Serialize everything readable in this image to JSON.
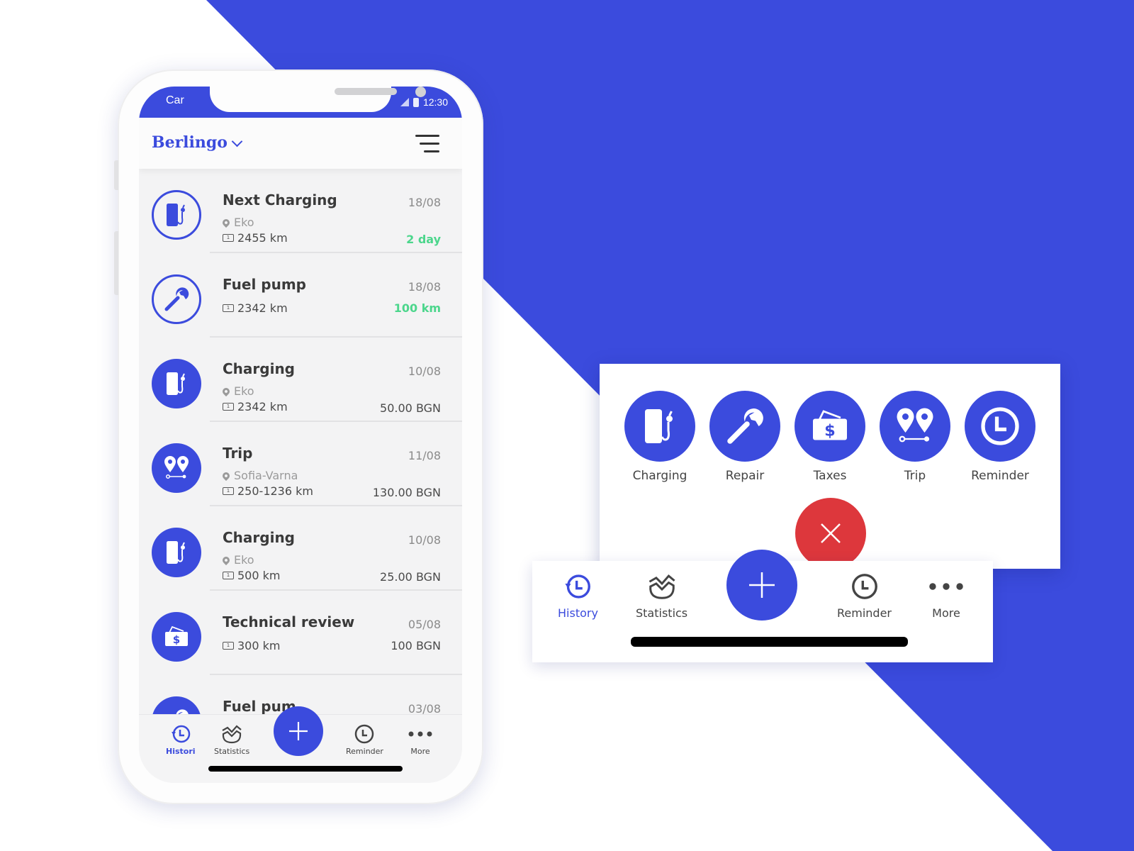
{
  "colors": {
    "brand_blue": "#3b4bdd",
    "danger_red": "#dd373c",
    "positive_green": "#4cd68c",
    "background": "#ffffff"
  },
  "phone": {
    "status_bar": {
      "carrier": "Car",
      "time": "12:30",
      "icons": [
        "signal-icon",
        "battery-icon"
      ]
    },
    "app_bar": {
      "vehicle_selector": "Berlingo",
      "menu_icon": "hamburger-menu-icon"
    },
    "list": [
      {
        "title": "Next Charging",
        "date": "18/08",
        "location": "Eko",
        "odometer": "2455 km",
        "value": "2 day",
        "value_style": "green",
        "icon": "charging-station-icon",
        "icon_style": "outline"
      },
      {
        "title": "Fuel pump",
        "date": "18/08",
        "location": null,
        "odometer": "2342 km",
        "value": "100 km",
        "value_style": "green",
        "icon": "wrench-icon",
        "icon_style": "outline"
      },
      {
        "title": "Charging",
        "date": "10/08",
        "location": "Eko",
        "odometer": "2342 km",
        "value": "50.00 BGN",
        "value_style": "normal",
        "icon": "charging-station-icon",
        "icon_style": "filled"
      },
      {
        "title": "Trip",
        "date": "11/08",
        "location": "Sofia-Varna",
        "odometer": "250-1236 km",
        "value": "130.00 BGN",
        "value_style": "normal",
        "icon": "trip-pins-icon",
        "icon_style": "filled"
      },
      {
        "title": "Charging",
        "date": "10/08",
        "location": "Eko",
        "odometer": "500 km",
        "value": "25.00 BGN",
        "value_style": "normal",
        "icon": "charging-station-icon",
        "icon_style": "filled"
      },
      {
        "title": "Technical review",
        "date": "05/08",
        "location": null,
        "odometer": "300 km",
        "value": "100 BGN",
        "value_style": "normal",
        "icon": "money-wallet-icon",
        "icon_style": "filled"
      },
      {
        "title": "Fuel pum",
        "date": "03/08",
        "location": null,
        "odometer": null,
        "value": null,
        "value_style": "normal",
        "icon": "wrench-icon",
        "icon_style": "filled"
      }
    ],
    "tabbar": {
      "tabs": [
        {
          "label": "Histori",
          "icon": "history-icon",
          "active": true
        },
        {
          "label": "Statistics",
          "icon": "statistics-icon",
          "active": false
        },
        {
          "label": "Reminder",
          "icon": "clock-icon",
          "active": false
        },
        {
          "label": "More",
          "icon": "more-dots-icon",
          "active": false
        }
      ],
      "fab_icon": "plus-icon"
    }
  },
  "action_menu": {
    "actions": [
      {
        "label": "Charging",
        "icon": "charging-station-icon"
      },
      {
        "label": "Repair",
        "icon": "wrench-icon"
      },
      {
        "label": "Taxes",
        "icon": "money-wallet-icon"
      },
      {
        "label": "Trip",
        "icon": "trip-pins-icon"
      },
      {
        "label": "Reminder",
        "icon": "clock-icon"
      }
    ],
    "close_icon": "close-icon"
  },
  "bottom_nav": {
    "tabs": [
      {
        "label": "History",
        "icon": "history-icon",
        "active": true
      },
      {
        "label": "Statistics",
        "icon": "statistics-icon",
        "active": false
      },
      {
        "label": "Reminder",
        "icon": "clock-icon",
        "active": false
      },
      {
        "label": "More",
        "icon": "more-dots-icon",
        "active": false
      }
    ],
    "fab_icon": "plus-icon"
  }
}
